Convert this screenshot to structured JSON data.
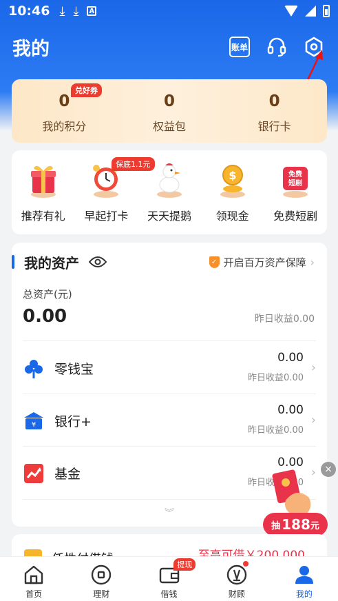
{
  "status_bar": {
    "time": "10:46"
  },
  "header": {
    "title": "我的",
    "bill_label": "账单"
  },
  "points": {
    "coupon_badge": "兑好券",
    "items": [
      {
        "value": "0",
        "label": "我的积分"
      },
      {
        "value": "0",
        "label": "权益包"
      },
      {
        "value": "0",
        "label": "银行卡"
      }
    ]
  },
  "activities": {
    "guarantee_badge": "保底1.1元",
    "items": [
      {
        "label": "推荐有礼",
        "icon": "gift-icon"
      },
      {
        "label": "早起打卡",
        "icon": "alarm-clock-icon"
      },
      {
        "label": "天天提鹅",
        "icon": "goose-icon"
      },
      {
        "label": "领现金",
        "icon": "coin-icon"
      },
      {
        "label": "免费短剧",
        "icon": "drama-icon",
        "icon_text": "免费短剧"
      }
    ]
  },
  "assets": {
    "title": "我的资产",
    "protect_label": "开启百万资产保障",
    "total_label": "总资产(元)",
    "total_value": "0.00",
    "total_yesterday": "昨日收益0.00",
    "rows": [
      {
        "name": "零钱宝",
        "value": "0.00",
        "yesterday": "昨日收益0.00"
      },
      {
        "name": "银行+",
        "value": "0.00",
        "yesterday": "昨日收益0.00"
      },
      {
        "name": "基金",
        "value": "0.00",
        "yesterday": "昨日收益0.00"
      }
    ]
  },
  "floating": {
    "prefix": "抽",
    "amount": "188",
    "unit": "元"
  },
  "loan": {
    "name": "任性付借钱",
    "amount": "至高可借￥200,000"
  },
  "bottom_nav": {
    "items": [
      {
        "label": "首页"
      },
      {
        "label": "理财"
      },
      {
        "label": "借钱",
        "badge": "提现"
      },
      {
        "label": "财顾"
      },
      {
        "label": "我的"
      }
    ]
  },
  "colors": {
    "primary": "#1a67e8",
    "accent_red": "#ee3b2f",
    "gold_text": "#6b3f16"
  }
}
